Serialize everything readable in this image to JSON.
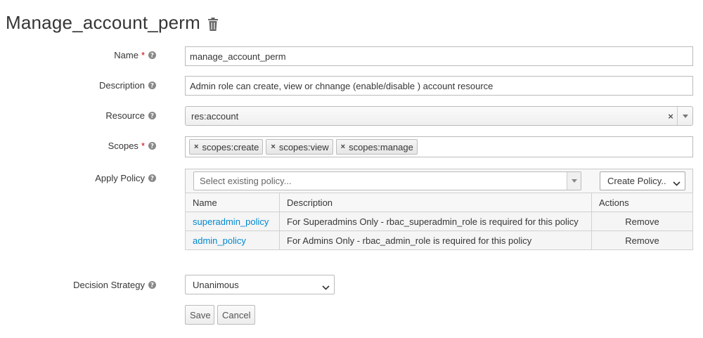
{
  "page": {
    "title": "Manage_account_perm",
    "delete_icon": "trash-icon"
  },
  "form": {
    "name": {
      "label": "Name",
      "required_mark": "*",
      "value": "manage_account_perm"
    },
    "description": {
      "label": "Description",
      "value": "Admin role can create, view or chnange (enable/disable ) account resource"
    },
    "resource": {
      "label": "Resource",
      "value": "res:account",
      "clear_glyph": "×"
    },
    "scopes": {
      "label": "Scopes",
      "required_mark": "*",
      "items": [
        "scopes:create",
        "scopes:view",
        "scopes:manage"
      ],
      "remove_glyph": "×"
    },
    "apply_policy": {
      "label": "Apply Policy",
      "select_placeholder": "Select existing policy...",
      "create_button": "Create Policy..",
      "table": {
        "headers": [
          "Name",
          "Description",
          "Actions"
        ],
        "rows": [
          {
            "name": "superadmin_policy",
            "description": "For Superadmins Only - rbac_superadmin_role is required for this policy",
            "action": "Remove"
          },
          {
            "name": "admin_policy",
            "description": "For Admins Only - rbac_admin_role is required for this policy",
            "action": "Remove"
          }
        ]
      }
    },
    "decision_strategy": {
      "label": "Decision Strategy",
      "value": "Unanimous"
    }
  },
  "buttons": {
    "save": "Save",
    "cancel": "Cancel"
  },
  "colors": {
    "link": "#0088ce",
    "required": "#cc0000",
    "text": "#363636"
  },
  "icons": {
    "help": "question-circle-icon",
    "dropdown": "caret-down-icon",
    "chevron": "chevron-down-icon"
  }
}
